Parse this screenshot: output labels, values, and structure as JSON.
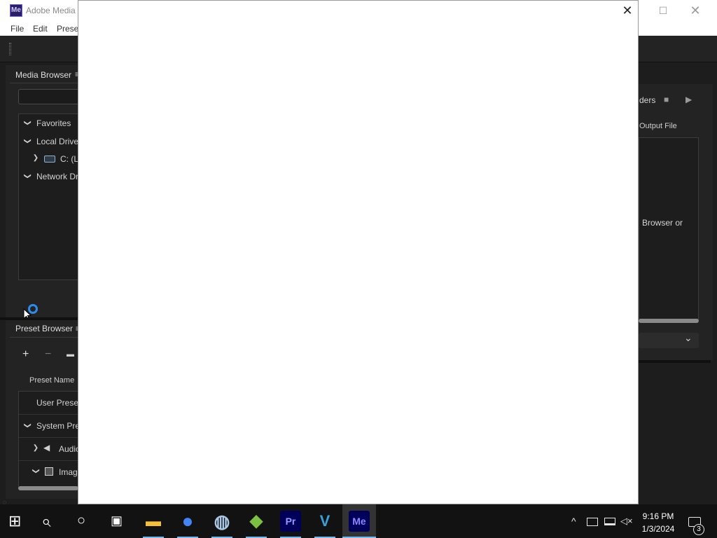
{
  "window": {
    "logo": "Me",
    "title": "Adobe Media",
    "minimize_glyph": "—",
    "maximize_glyph": "☐",
    "close_glyph": "✕"
  },
  "menu": {
    "items": [
      "File",
      "Edit",
      "Preset"
    ]
  },
  "media_browser": {
    "title": "Media Browser",
    "menu_glyph": "≡",
    "search_value": "",
    "tree": [
      {
        "label": "Favorites",
        "chevron": "❯"
      },
      {
        "label": "Local Drives",
        "chevron": "❯"
      },
      {
        "label": "C: (Lo",
        "chevron": "❯"
      },
      {
        "label": "Network Dri",
        "chevron": "❯"
      }
    ]
  },
  "preset_browser": {
    "title": "Preset Browser",
    "add_glyph": "+",
    "remove_glyph": "−",
    "folder_glyph": "▬",
    "column_header": "Preset Name",
    "rows": [
      {
        "label": "User Presets"
      },
      {
        "label": "System Pres",
        "chevron": "❯"
      },
      {
        "label": "Audio",
        "chevron": "❯"
      },
      {
        "label": "Image",
        "chevron": "❯"
      }
    ]
  },
  "queue": {
    "renders_label": "ders",
    "stop_glyph": "■",
    "play_glyph": "▶",
    "output_file_header": "Output File",
    "hint_text": "Browser or",
    "dropdown_chevron": "⌄"
  },
  "dialog": {
    "close_glyph": "✕"
  },
  "taskbar": {
    "start_glyph": "⊞",
    "search_glyph": "⌕",
    "cortana_glyph": "○",
    "taskview_glyph": "▣",
    "apps": [
      {
        "name": "File Explorer",
        "icon": "folder-icon",
        "glyph": "▬",
        "color": "#f3c037"
      },
      {
        "name": "Chrome",
        "icon": "chrome-icon",
        "glyph": "●",
        "color": "#4285f4"
      },
      {
        "name": "App",
        "icon": "globe-icon",
        "glyph": "◍",
        "color": "#a9c7e6"
      },
      {
        "name": "App",
        "icon": "gem-icon",
        "glyph": "◆",
        "color": "#7bc142"
      },
      {
        "name": "Premiere Pro",
        "icon": "premiere-icon",
        "glyph": "Pr",
        "color": "#9999ff"
      },
      {
        "name": "App",
        "icon": "vimeo-icon",
        "glyph": "V",
        "color": "#3aa0d8"
      },
      {
        "name": "Media Encoder",
        "icon": "media-encoder-icon",
        "glyph": "Me",
        "color": "#8d84ff"
      }
    ],
    "tray_chevron": "^",
    "clock_time": "9:16 PM",
    "clock_date": "1/3/2024",
    "notification_count": "3",
    "accent_color": "#76b9ed"
  }
}
